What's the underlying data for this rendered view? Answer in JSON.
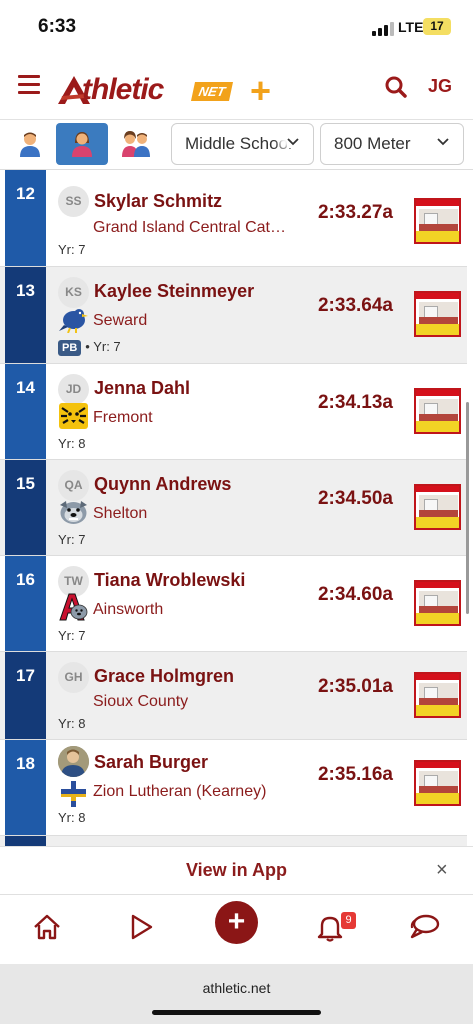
{
  "status_bar": {
    "time": "6:33",
    "network": "LTE",
    "battery": "17"
  },
  "header": {
    "logo_text": "thletic",
    "logo_badge": "NET",
    "logo_plus": "+",
    "user_initials": "JG",
    "brand_color": "#9b1a1a",
    "accent_color": "#f2a21b"
  },
  "filters": {
    "gender_icons": [
      "boy-icon",
      "girl-icon",
      "both-genders-icon"
    ],
    "active_gender": 1,
    "division": "Middle School",
    "event": "800 Meter"
  },
  "results": [
    {
      "rank": "12",
      "initials": "SS",
      "name": "Skylar Schmitz",
      "school": "Grand Island Central Cat…",
      "meta": "Yr: 7",
      "pb": false,
      "time": "2:33.27a",
      "school_logo": ""
    },
    {
      "rank": "13",
      "initials": "KS",
      "name": "Kaylee Steinmeyer",
      "school": "Seward",
      "meta": "• Yr: 7",
      "pb": true,
      "pb_label": "PB",
      "time": "2:33.64a",
      "school_logo": "bluejay-logo"
    },
    {
      "rank": "14",
      "initials": "JD",
      "name": "Jenna Dahl",
      "school": "Fremont",
      "meta": "Yr: 8",
      "pb": false,
      "time": "2:34.13a",
      "school_logo": "tiger-logo"
    },
    {
      "rank": "15",
      "initials": "QA",
      "name": "Quynn Andrews",
      "school": "Shelton",
      "meta": "Yr: 7",
      "pb": false,
      "time": "2:34.50a",
      "school_logo": "bulldog-logo"
    },
    {
      "rank": "16",
      "initials": "TW",
      "name": "Tiana Wroblewski",
      "school": "Ainsworth",
      "meta": "Yr: 7",
      "pb": false,
      "time": "2:34.60a",
      "school_logo": "a-bulldog-logo"
    },
    {
      "rank": "17",
      "initials": "GH",
      "name": "Grace Holmgren",
      "school": "Sioux County",
      "meta": "Yr: 8",
      "pb": false,
      "time": "2:35.01a",
      "school_logo": ""
    },
    {
      "rank": "18",
      "initials": "",
      "name": "Sarah Burger",
      "school": "Zion Lutheran (Kearney)",
      "meta": "Yr: 8",
      "pb": false,
      "time": "2:35.16a",
      "school_logo": "cross-logo"
    }
  ],
  "banner": {
    "text": "View in App",
    "close": "×"
  },
  "bottom_nav": {
    "items": [
      "home-icon",
      "play-icon",
      "add-icon",
      "bell-icon",
      "chat-icon"
    ],
    "plus_label": "+",
    "notification_count": "9"
  },
  "browser": {
    "url": "athletic.net"
  }
}
